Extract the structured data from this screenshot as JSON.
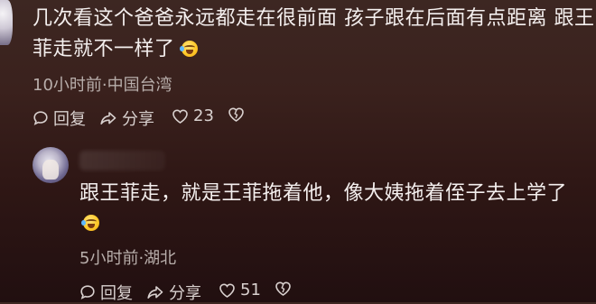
{
  "comments": [
    {
      "text_line1": "几次看这个爸爸永远都走在很前面 孩子跟在后面有点距离  跟王",
      "text_line2": "菲走就不一样了",
      "emoji": "cry-laugh-emoji",
      "meta": "10小时前·中国台湾",
      "actions": {
        "reply": "回复",
        "share": "分享",
        "likes": "23"
      }
    },
    {
      "text_line1": "跟王菲走，就是王菲拖着他，像大姨拖着侄子去上学了",
      "emoji": "cry-laugh-emoji",
      "meta": "5小时前·湖北",
      "actions": {
        "reply": "回复",
        "share": "分享",
        "likes": "51"
      }
    }
  ],
  "colors": {
    "background_top": "#3d2722",
    "background_bottom": "#210f10",
    "text": "#f4efee",
    "meta": "#b8aeab"
  }
}
